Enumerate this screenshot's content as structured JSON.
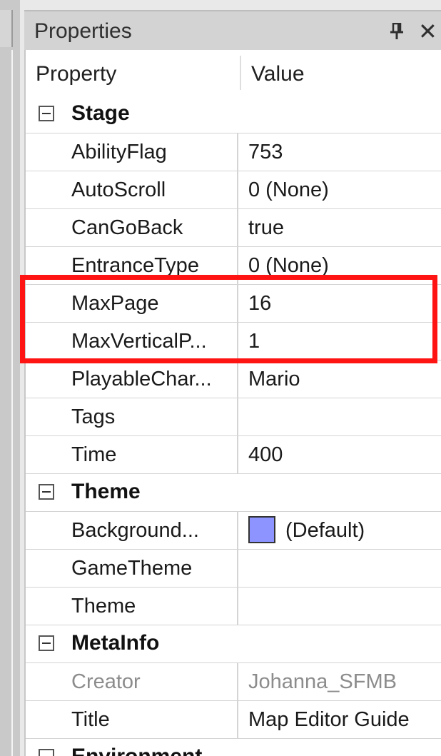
{
  "panel": {
    "title": "Properties",
    "pin_icon": "pin-icon",
    "close_glyph": "✕"
  },
  "grid": {
    "header": {
      "property": "Property",
      "value": "Value"
    },
    "categories": [
      {
        "label": "Stage",
        "rows": [
          {
            "name": "AbilityFlag",
            "value": "753"
          },
          {
            "name": "AutoScroll",
            "value": "0 (None)"
          },
          {
            "name": "CanGoBack",
            "value": "true"
          },
          {
            "name": "EntranceType",
            "value": "0 (None)"
          },
          {
            "name": "MaxPage",
            "value": "16"
          },
          {
            "name": "MaxVerticalP...",
            "value": "1"
          },
          {
            "name": "PlayableChar...",
            "value": "Mario"
          },
          {
            "name": "Tags",
            "value": ""
          },
          {
            "name": "Time",
            "value": "400"
          }
        ]
      },
      {
        "label": "Theme",
        "rows": [
          {
            "name": "Background...",
            "value": "(Default)",
            "swatch_color": "#8d94ff"
          },
          {
            "name": "GameTheme",
            "value": ""
          },
          {
            "name": "Theme",
            "value": ""
          }
        ]
      },
      {
        "label": "MetaInfo",
        "rows": [
          {
            "name": "Creator",
            "value": "Johanna_SFMB",
            "disabled": true
          },
          {
            "name": "Title",
            "value": "Map Editor Guide"
          }
        ]
      },
      {
        "label": "Environment",
        "rows": []
      }
    ]
  },
  "highlight_color": "#ff1414"
}
